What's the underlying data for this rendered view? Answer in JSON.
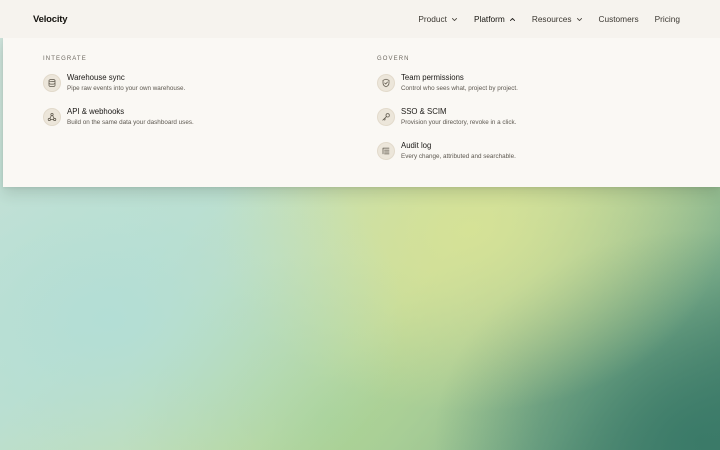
{
  "brand": {
    "name": "Velocity"
  },
  "nav": {
    "items": [
      {
        "label": "Product",
        "has_menu": true,
        "open": false
      },
      {
        "label": "Platform",
        "has_menu": true,
        "open": true
      },
      {
        "label": "Resources",
        "has_menu": true,
        "open": false
      },
      {
        "label": "Customers",
        "has_menu": false
      },
      {
        "label": "Pricing",
        "has_menu": false
      }
    ]
  },
  "menu": {
    "integrate": {
      "heading": "INTEGRATE",
      "items": [
        {
          "title": "Warehouse sync",
          "desc": "Pipe raw events into your own warehouse.",
          "icon": "database-icon"
        },
        {
          "title": "API & webhooks",
          "desc": "Build on the same data your dashboard uses.",
          "icon": "webhook-icon"
        }
      ]
    },
    "govern": {
      "heading": "GOVERN",
      "items": [
        {
          "title": "Team permissions",
          "desc": "Control who sees what, project by project.",
          "icon": "shield-check-icon"
        },
        {
          "title": "SSO & SCIM",
          "desc": "Provision your directory, revoke in a click.",
          "icon": "key-icon"
        },
        {
          "title": "Audit log",
          "desc": "Every change, attributed and searchable.",
          "icon": "list-log-icon"
        }
      ]
    }
  },
  "colors": {
    "nav_bg": "#f6f3ee",
    "panel_bg": "#faf8f4",
    "icon_bg": "#ece6da",
    "text": "#1a1815",
    "muted": "#5d5850"
  }
}
